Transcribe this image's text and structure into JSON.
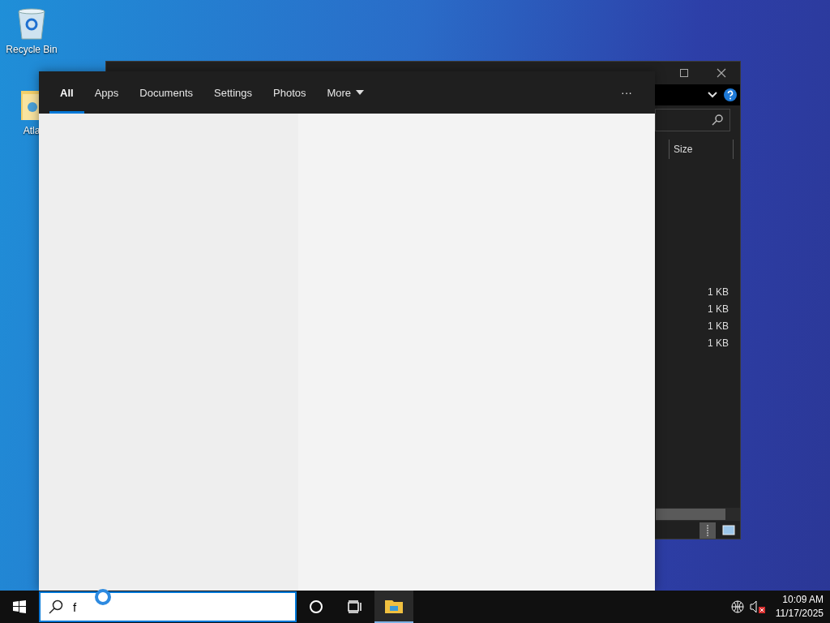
{
  "desktop_icons": [
    {
      "label": "Recycle Bin",
      "kind": "recycle"
    },
    {
      "label": "Atla",
      "kind": "folder"
    }
  ],
  "explorer": {
    "column_header": "Size",
    "sizes": [
      "1 KB",
      "1 KB",
      "1 KB",
      "1 KB"
    ]
  },
  "search_panel": {
    "tabs": [
      {
        "label": "All",
        "selected": true
      },
      {
        "label": "Apps",
        "selected": false
      },
      {
        "label": "Documents",
        "selected": false
      },
      {
        "label": "Settings",
        "selected": false
      },
      {
        "label": "Photos",
        "selected": false
      },
      {
        "label": "More",
        "selected": false
      }
    ],
    "more_menu": "···"
  },
  "taskbar": {
    "search": {
      "value": "f"
    },
    "file_explorer_active": true,
    "clock": {
      "time": "10:09 AM",
      "date": "11/17/2025"
    }
  }
}
